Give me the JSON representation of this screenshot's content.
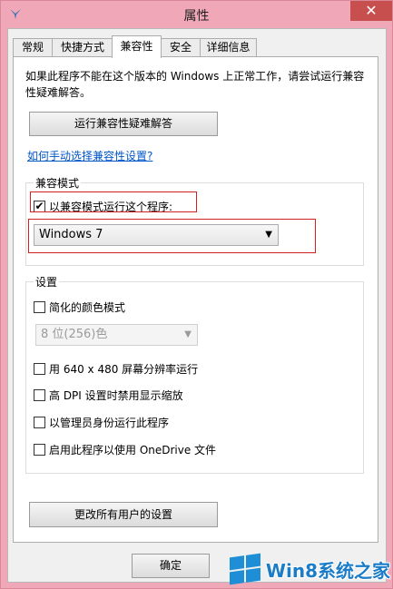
{
  "window": {
    "title": "属性",
    "close_glyph": "✕"
  },
  "tabs": [
    "常规",
    "快捷方式",
    "兼容性",
    "安全",
    "详细信息"
  ],
  "compat": {
    "description": "如果此程序不能在这个版本的 Windows 上正常工作，请尝试运行兼容性疑难解答。",
    "troubleshoot_button": "运行兼容性疑难解答",
    "manual_link": "如何手动选择兼容性设置?",
    "mode_group_label": "兼容模式",
    "mode_checkbox_label": "以兼容模式运行这个程序:",
    "mode_checkbox_checked": true,
    "mode_select_value": "Windows 7"
  },
  "settings": {
    "group_label": "设置",
    "reduced_color": "简化的颜色模式",
    "color_select_value": "8 位(256)色",
    "res_640": "用 640 x 480 屏幕分辨率运行",
    "dpi": "高 DPI 设置时禁用显示缩放",
    "admin": "以管理员身份运行此程序",
    "onedrive": "启用此程序以使用 OneDrive 文件"
  },
  "change_all_button": "更改所有用户的设置",
  "ok_button": "确定",
  "watermark": {
    "text": "Win8系统之家"
  },
  "colors": {
    "accent": "#0055c8",
    "highlight": "#d62020",
    "close": "#c7504f"
  }
}
